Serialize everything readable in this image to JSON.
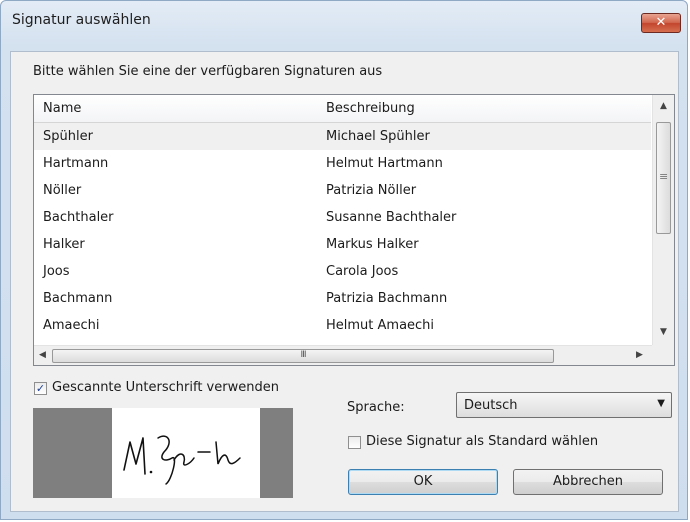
{
  "window": {
    "title": "Signatur auswählen",
    "close_glyph": "✕"
  },
  "instruction": "Bitte wählen Sie eine der verfügbaren Signaturen aus",
  "list": {
    "columns": [
      "Name",
      "Beschreibung"
    ],
    "rows": [
      {
        "name": "Spühler",
        "description": "Michael Spühler"
      },
      {
        "name": "Hartmann",
        "description": "Helmut Hartmann"
      },
      {
        "name": "Nöller",
        "description": "Patrizia Nöller"
      },
      {
        "name": "Bachthaler",
        "description": "Susanne Bachthaler"
      },
      {
        "name": "Halker",
        "description": "Markus Halker"
      },
      {
        "name": "Joos",
        "description": "Carola Joos"
      },
      {
        "name": "Bachmann",
        "description": "Patrizia Bachmann"
      },
      {
        "name": "Amaechi",
        "description": "Helmut Amaechi"
      }
    ],
    "selected_index": 0,
    "hscroll_grip": "III",
    "vscroll_grip": "≡"
  },
  "scanned_signature": {
    "label": "Gescannte Unterschrift verwenden",
    "checked": true,
    "check_glyph": "✓",
    "signature_text": "M. Spühler"
  },
  "language": {
    "label": "Sprache:",
    "selected": "Deutsch"
  },
  "default_checkbox": {
    "label": "Diese Signatur als Standard wählen",
    "checked": false
  },
  "buttons": {
    "ok": "OK",
    "cancel": "Abbrechen"
  }
}
